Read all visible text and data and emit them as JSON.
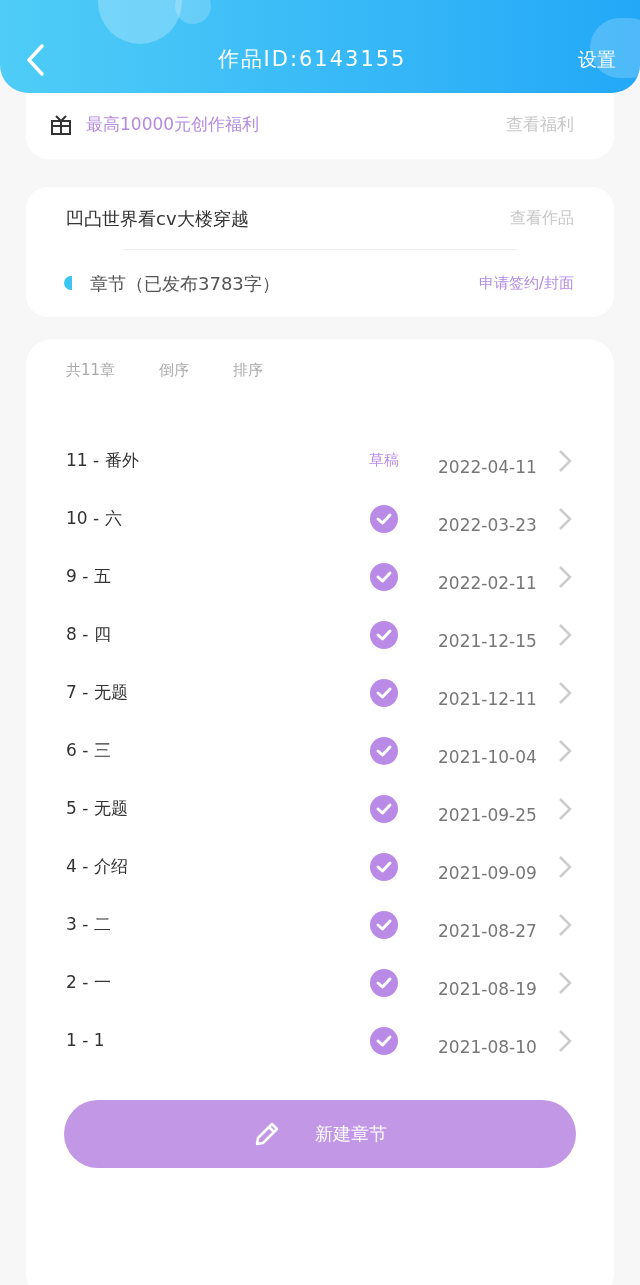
{
  "header": {
    "title": "作品ID:6143155",
    "settings": "设置"
  },
  "benefit": {
    "text": "最高10000元创作福利",
    "link": "查看福利"
  },
  "work": {
    "title": "凹凸世界看cv大楼穿越",
    "link": "查看作品",
    "section": "章节（已发布3783字）",
    "apply": "申请签约/封面"
  },
  "toolbar": {
    "count": "共11章",
    "reverse": "倒序",
    "sort": "排序"
  },
  "chapters": [
    {
      "title": "11 - 番外",
      "published": false,
      "status": "草稿",
      "date": "2022-04-11"
    },
    {
      "title": "10 - 六",
      "published": true,
      "date": "2022-03-23"
    },
    {
      "title": "9 - 五",
      "published": true,
      "date": "2022-02-11"
    },
    {
      "title": "8 - 四",
      "published": true,
      "date": "2021-12-15"
    },
    {
      "title": "7 - 无题",
      "published": true,
      "date": "2021-12-11"
    },
    {
      "title": "6 - 三",
      "published": true,
      "date": "2021-10-04"
    },
    {
      "title": "5 - 无题",
      "published": true,
      "date": "2021-09-25"
    },
    {
      "title": "4 - 介绍",
      "published": true,
      "date": "2021-09-09"
    },
    {
      "title": "3 - 二",
      "published": true,
      "date": "2021-08-27"
    },
    {
      "title": "2 - 一",
      "published": true,
      "date": "2021-08-19"
    },
    {
      "title": "1 - 1",
      "published": true,
      "date": "2021-08-10"
    }
  ],
  "new_button": "新建章节"
}
